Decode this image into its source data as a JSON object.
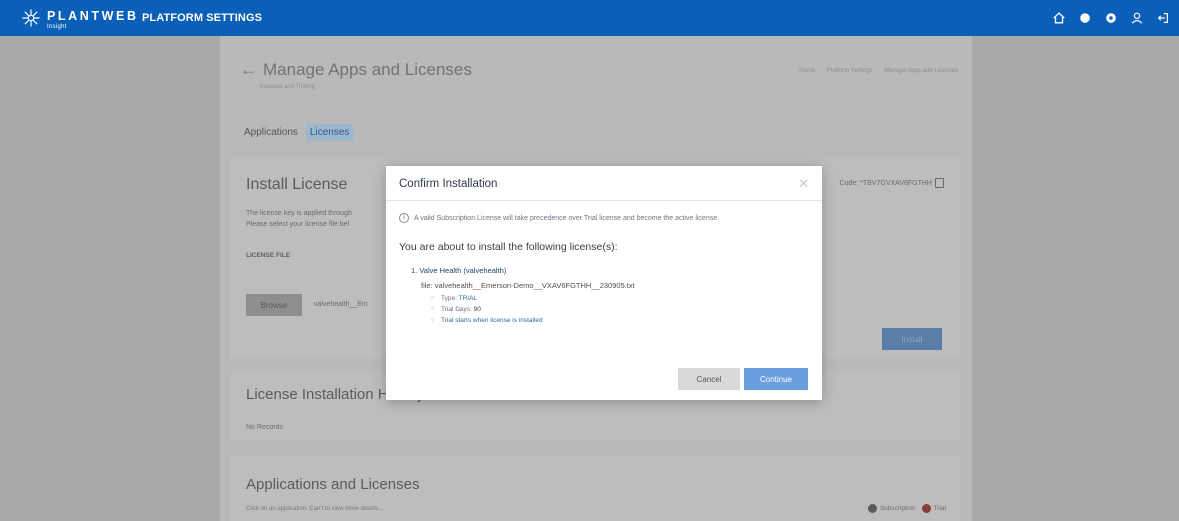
{
  "topbar": {
    "brand": "PLANTWEB",
    "brand_sub": "Insight",
    "title": "PLATFORM SETTINGS",
    "icons": [
      "home-icon",
      "dot-icon",
      "settings-dot-icon",
      "user-icon",
      "logout-icon"
    ]
  },
  "page": {
    "back_title": "Manage Apps and Licenses",
    "subtitle": "Installed and Trialing",
    "breadcrumbs": [
      "Home",
      "Platform Settings",
      "Manage Apps and Licenses"
    ],
    "tabs": [
      "Applications",
      "Licenses"
    ],
    "install_card": {
      "title": "Install License",
      "text_line1": "The license key is applied through",
      "text_line2": "Please select your license file bel",
      "field_label": "LICENSE FILE",
      "browse_label": "Browse",
      "file_name": "valvehealth__Em",
      "code": "Code: *TBV7GVXAV6FGTHH",
      "install_label": "Install"
    },
    "history_card": {
      "title": "License Installation History",
      "text": "No Records"
    },
    "apps_card": {
      "title": "Applications and Licenses",
      "text": "Click on an application. Can't to view more details...",
      "legend_subscription": "Subscription",
      "legend_trial": "Trial"
    }
  },
  "modal": {
    "title": "Confirm Installation",
    "info": "A valid Subscription License will take precedence over Trial license and become the active license.",
    "intro": "You are about to install the following license(s):",
    "license_name": "1. Valve Health (valvehealth)",
    "file": "file: valvehealth__Emerson-Demo__VXAV6FGTHH__230905.txt",
    "type_label": "Type:",
    "type_value": "TRIAL",
    "days_label": "Trial Days:",
    "days_value": "90",
    "trial_note": "Trial starts when license is installed",
    "cancel_label": "Cancel",
    "continue_label": "Continue"
  },
  "colors": {
    "topbar": "#0a5fb8",
    "accent": "#6a9fde",
    "license_name": "#20466b"
  }
}
